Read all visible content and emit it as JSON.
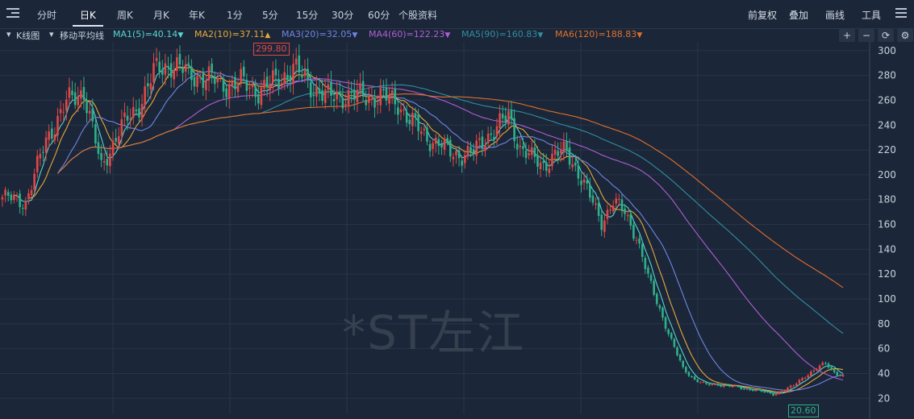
{
  "toolbar": {
    "tabs": [
      {
        "label": "分时",
        "active": false
      },
      {
        "label": "日K",
        "active": true
      },
      {
        "label": "周K",
        "active": false
      },
      {
        "label": "月K",
        "active": false
      },
      {
        "label": "年K",
        "active": false
      },
      {
        "label": "1分",
        "active": false
      },
      {
        "label": "5分",
        "active": false
      },
      {
        "label": "15分",
        "active": false
      },
      {
        "label": "30分",
        "active": false
      },
      {
        "label": "60分",
        "active": false
      },
      {
        "label": "个股资料",
        "active": false
      }
    ],
    "right": {
      "adjust": "前复权",
      "overlay": "叠加",
      "draw": "画线",
      "tools": "工具"
    }
  },
  "indicators": {
    "kline_label": "K线图",
    "ma_label": "移动平均线",
    "items": [
      {
        "text": "MA1(5)=40.14",
        "arrow": "▼",
        "color": "#55d6d1"
      },
      {
        "text": "MA2(10)=37.11",
        "arrow": "▲",
        "color": "#e8a93a"
      },
      {
        "text": "MA3(20)=32.05",
        "arrow": "▼",
        "color": "#6f86e3"
      },
      {
        "text": "MA4(60)=122.23",
        "arrow": "▼",
        "color": "#b05ed3"
      },
      {
        "text": "MA5(90)=160.83",
        "arrow": "▼",
        "color": "#2e8fa0"
      },
      {
        "text": "MA6(120)=188.83",
        "arrow": "▼",
        "color": "#e0702c"
      }
    ],
    "controls": {
      "plus": "+",
      "minus": "−",
      "refresh": "⟳",
      "settings": "⚙"
    }
  },
  "chart": {
    "watermark": "*ST左江",
    "y_ticks": [
      300,
      280,
      260,
      240,
      220,
      200,
      180,
      160,
      140,
      120,
      100,
      80,
      60,
      40,
      20
    ],
    "high_label": "299.80",
    "low_label": "20.60",
    "colors": {
      "up": "#e04848",
      "down": "#2fb08a",
      "grid": "#28354a"
    }
  },
  "chart_data": {
    "type": "candlestick",
    "title": "*ST左江",
    "ylim": [
      15,
      307
    ],
    "max_price": 299.8,
    "min_price": 20.6,
    "close_path": [
      [
        0,
        182
      ],
      [
        8,
        178
      ],
      [
        15,
        228
      ],
      [
        22,
        258
      ],
      [
        28,
        268
      ],
      [
        34,
        205
      ],
      [
        40,
        236
      ],
      [
        46,
        252
      ],
      [
        52,
        282
      ],
      [
        58,
        290
      ],
      [
        64,
        281
      ],
      [
        70,
        278
      ],
      [
        76,
        273
      ],
      [
        82,
        274
      ],
      [
        88,
        268
      ],
      [
        94,
        275
      ],
      [
        100,
        286
      ],
      [
        106,
        272
      ],
      [
        112,
        262
      ],
      [
        118,
        264
      ],
      [
        124,
        263
      ],
      [
        130,
        263
      ],
      [
        136,
        258
      ],
      [
        140,
        244
      ],
      [
        146,
        230
      ],
      [
        150,
        225
      ],
      [
        154,
        218
      ],
      [
        158,
        216
      ],
      [
        162,
        218
      ],
      [
        166,
        230
      ],
      [
        170,
        238
      ],
      [
        174,
        247
      ],
      [
        178,
        222
      ],
      [
        182,
        213
      ],
      [
        186,
        208
      ],
      [
        190,
        216
      ],
      [
        194,
        219
      ],
      [
        198,
        202
      ],
      [
        202,
        182
      ],
      [
        206,
        162
      ],
      [
        210,
        178
      ],
      [
        214,
        170
      ],
      [
        218,
        150
      ],
      [
        222,
        117
      ],
      [
        226,
        92
      ],
      [
        230,
        66
      ],
      [
        234,
        44
      ],
      [
        238,
        35
      ],
      [
        242,
        31
      ],
      [
        246,
        31
      ],
      [
        250,
        30
      ],
      [
        254,
        28
      ],
      [
        258,
        27
      ],
      [
        262,
        25
      ],
      [
        265,
        23
      ],
      [
        268,
        26
      ],
      [
        272,
        30
      ],
      [
        276,
        38
      ],
      [
        280,
        44
      ],
      [
        283,
        48
      ],
      [
        286,
        41
      ],
      [
        289,
        38
      ]
    ],
    "moving_averages": [
      {
        "name": "MA1(5)",
        "last": 40.14
      },
      {
        "name": "MA2(10)",
        "last": 37.11
      },
      {
        "name": "MA3(20)",
        "last": 32.05
      },
      {
        "name": "MA4(60)",
        "last": 122.23
      },
      {
        "name": "MA5(90)",
        "last": 160.83
      },
      {
        "name": "MA6(120)",
        "last": 188.83
      }
    ]
  }
}
